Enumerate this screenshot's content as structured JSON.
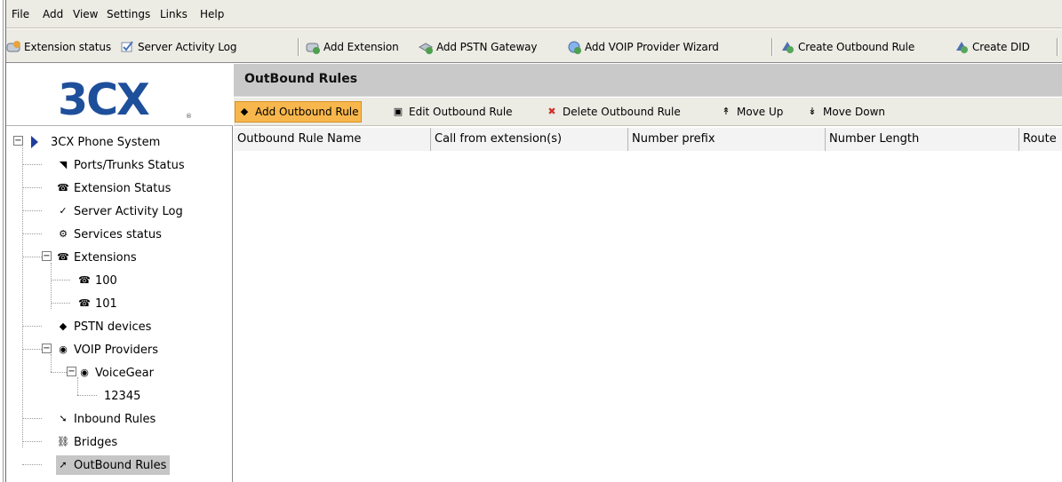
{
  "menu": [
    "File",
    "Add",
    "View",
    "Settings",
    "Links",
    "Help"
  ],
  "toolbar": [
    {
      "label": "Extension status",
      "icon": "phone-icon"
    },
    {
      "label": "Server Activity Log",
      "icon": "checklist-icon"
    },
    {
      "label": "Add Extension",
      "icon": "add-phone-icon"
    },
    {
      "label": "Add PSTN Gateway",
      "icon": "gateway-icon"
    },
    {
      "label": "Add VOIP Provider Wizard",
      "icon": "provider-add-icon"
    },
    {
      "label": "Create Outbound Rule",
      "icon": "outbound-rule-icon"
    },
    {
      "label": "Create DID",
      "icon": "did-icon"
    }
  ],
  "logo": {
    "text": "3CX",
    "mark": "®"
  },
  "tree": {
    "root": "3CX Phone System",
    "items": [
      "Ports/Trunks Status",
      "Extension Status",
      "Server Activity Log",
      "Services status",
      "Extensions",
      "100",
      "101",
      "PSTN devices",
      "VOIP Providers",
      "VoiceGear",
      "12345",
      "Inbound Rules",
      "Bridges",
      "OutBound Rules"
    ]
  },
  "main": {
    "title": "OutBound Rules",
    "actions": [
      {
        "label": "Add Outbound Rule",
        "icon": "add-outbound-rule-icon"
      },
      {
        "label": "Edit Outbound Rule",
        "icon": "edit-icon"
      },
      {
        "label": "Delete Outbound Rule",
        "icon": "delete-icon"
      },
      {
        "label": "Move Up",
        "icon": "move-up-icon"
      },
      {
        "label": "Move Down",
        "icon": "move-down-icon"
      }
    ],
    "columns": [
      "Outbound Rule Name",
      "Call from extension(s)",
      "Number prefix",
      "Number Length",
      "Route"
    ]
  },
  "colors": {
    "logo": "#1e4f9a",
    "title_bar": "#c9c9c9",
    "selected_action": "#f8b74c",
    "selected_tree": "#c6c6c6"
  }
}
